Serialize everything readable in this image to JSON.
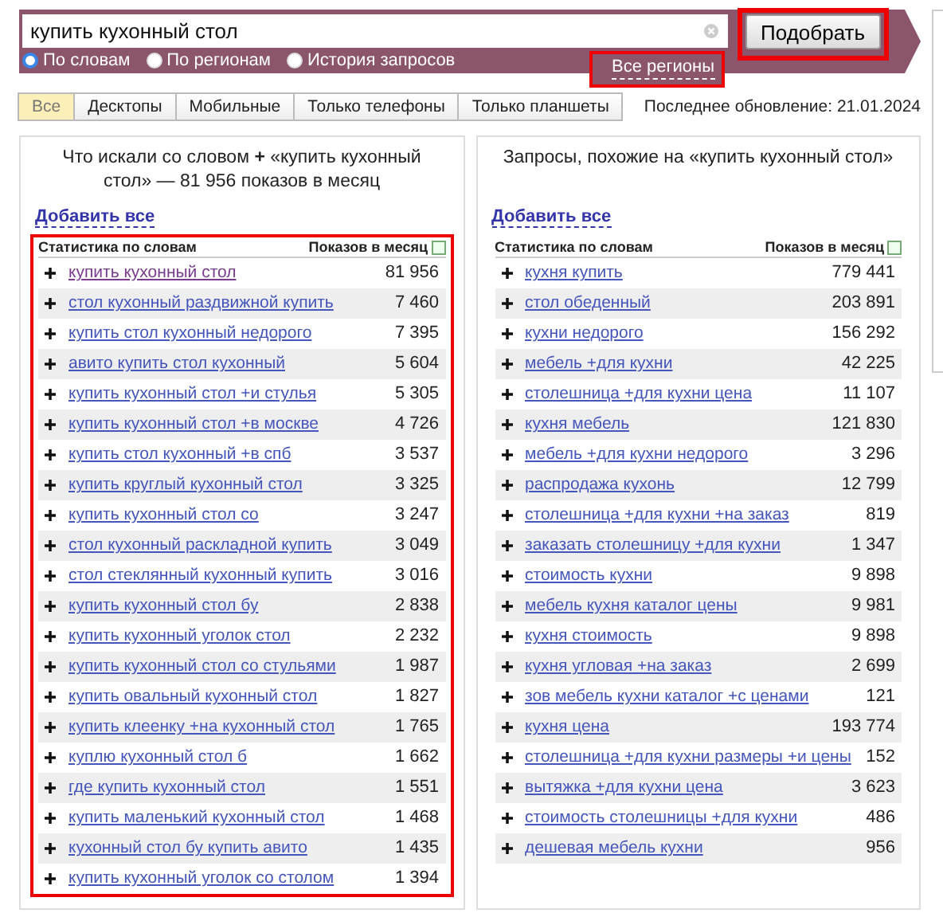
{
  "search": {
    "value": "купить кухонный стол",
    "button": "Подобрать",
    "modes": [
      {
        "label": "По словам",
        "selected": true
      },
      {
        "label": "По регионам",
        "selected": false
      },
      {
        "label": "История запросов",
        "selected": false
      }
    ],
    "region_link": "Все регионы"
  },
  "tabs": [
    {
      "label": "Все",
      "selected": true
    },
    {
      "label": "Десктопы",
      "selected": false
    },
    {
      "label": "Мобильные",
      "selected": false
    },
    {
      "label": "Только телефоны",
      "selected": false
    },
    {
      "label": "Только планшеты",
      "selected": false
    }
  ],
  "last_update": "Последнее обновление: 21.01.2024",
  "panels": [
    {
      "title_before": "Что искали со словом",
      "title_mark": "+",
      "title_after": "«купить кухонный стол» — 81 956 показов в месяц",
      "add_all": "Добавить все",
      "col_phrase": "Статистика по словам",
      "col_count": "Показов в месяц",
      "highlighted": true,
      "rows": [
        {
          "phrase": "купить кухонный стол",
          "count": "81 956",
          "visited": true
        },
        {
          "phrase": "стол кухонный раздвижной купить",
          "count": "7 460",
          "visited": false
        },
        {
          "phrase": "купить стол кухонный недорого",
          "count": "7 395",
          "visited": false
        },
        {
          "phrase": "авито купить стол кухонный",
          "count": "5 604",
          "visited": false
        },
        {
          "phrase": "купить кухонный стол +и стулья",
          "count": "5 305",
          "visited": false
        },
        {
          "phrase": "купить кухонный стол +в москве",
          "count": "4 726",
          "visited": false
        },
        {
          "phrase": "купить стол кухонный +в спб",
          "count": "3 537",
          "visited": false
        },
        {
          "phrase": "купить круглый кухонный стол",
          "count": "3 325",
          "visited": false
        },
        {
          "phrase": "купить кухонный стол со",
          "count": "3 247",
          "visited": false
        },
        {
          "phrase": "стол кухонный раскладной купить",
          "count": "3 049",
          "visited": false
        },
        {
          "phrase": "стол стеклянный кухонный купить",
          "count": "3 016",
          "visited": false
        },
        {
          "phrase": "купить кухонный стол бу",
          "count": "2 838",
          "visited": false
        },
        {
          "phrase": "купить кухонный уголок стол",
          "count": "2 232",
          "visited": false
        },
        {
          "phrase": "купить кухонный стол со стульями",
          "count": "1 987",
          "visited": false
        },
        {
          "phrase": "купить овальный кухонный стол",
          "count": "1 827",
          "visited": false
        },
        {
          "phrase": "купить клеенку +на кухонный стол",
          "count": "1 765",
          "visited": false
        },
        {
          "phrase": "куплю кухонный стол б",
          "count": "1 662",
          "visited": false
        },
        {
          "phrase": "где купить кухонный стол",
          "count": "1 551",
          "visited": false
        },
        {
          "phrase": "купить маленький кухонный стол",
          "count": "1 468",
          "visited": false
        },
        {
          "phrase": "кухонный стол бу купить авито",
          "count": "1 435",
          "visited": false
        },
        {
          "phrase": "купить кухонный уголок со столом",
          "count": "1 394",
          "visited": false
        }
      ]
    },
    {
      "title_before": "Запросы, похожие на «купить кухонный стол»",
      "add_all": "Добавить все",
      "col_phrase": "Статистика по словам",
      "col_count": "Показов в месяц",
      "highlighted": false,
      "rows": [
        {
          "phrase": "кухня купить",
          "count": "779 441",
          "visited": false
        },
        {
          "phrase": "стол обеденный",
          "count": "203 891",
          "visited": false
        },
        {
          "phrase": "кухни недорого",
          "count": "156 292",
          "visited": false
        },
        {
          "phrase": "мебель +для кухни",
          "count": "42 225",
          "visited": false
        },
        {
          "phrase": "столешница +для кухни цена",
          "count": "11 107",
          "visited": false
        },
        {
          "phrase": "кухня мебель",
          "count": "121 830",
          "visited": false
        },
        {
          "phrase": "мебель +для кухни недорого",
          "count": "3 296",
          "visited": false
        },
        {
          "phrase": "распродажа кухонь",
          "count": "12 799",
          "visited": false
        },
        {
          "phrase": "столешница +для кухни +на заказ",
          "count": "819",
          "visited": false
        },
        {
          "phrase": "заказать столешницу +для кухни",
          "count": "1 347",
          "visited": false
        },
        {
          "phrase": "стоимость кухни",
          "count": "9 898",
          "visited": false
        },
        {
          "phrase": "мебель кухня каталог цены",
          "count": "9 981",
          "visited": false
        },
        {
          "phrase": "кухня стоимость",
          "count": "9 898",
          "visited": false
        },
        {
          "phrase": "кухня угловая +на заказ",
          "count": "2 699",
          "visited": false
        },
        {
          "phrase": "зов мебель кухни каталог +с ценами",
          "count": "121",
          "visited": false
        },
        {
          "phrase": "кухня цена",
          "count": "193 774",
          "visited": false
        },
        {
          "phrase": "столешница +для кухни размеры +и цены",
          "count": "152",
          "visited": false
        },
        {
          "phrase": "вытяжка +для кухни цена",
          "count": "3 623",
          "visited": false
        },
        {
          "phrase": "стоимость столешницы +для кухни",
          "count": "486",
          "visited": false
        },
        {
          "phrase": "дешевая мебель кухни",
          "count": "956",
          "visited": false
        }
      ]
    }
  ]
}
